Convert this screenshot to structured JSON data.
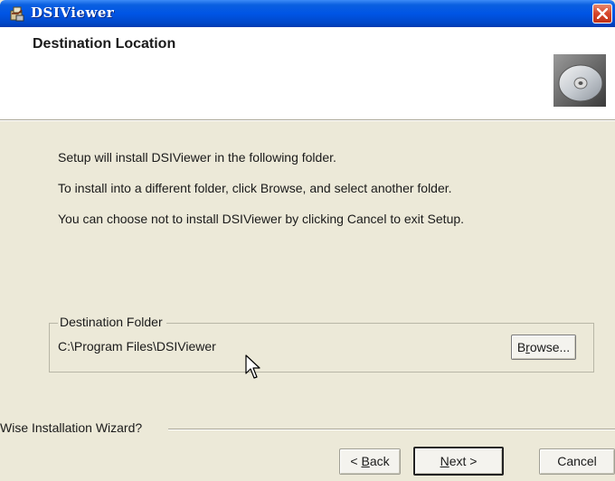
{
  "window": {
    "title": "DSIViewer"
  },
  "header": {
    "title": "Destination Location"
  },
  "body": {
    "lines": [
      "Setup will install DSIViewer in the following folder.",
      "To install into a different folder, click Browse, and select another folder.",
      "You can choose not to install DSIViewer by clicking Cancel to exit Setup."
    ]
  },
  "destination": {
    "legend": "Destination Folder",
    "path": "C:\\Program Files\\DSIViewer",
    "browse_label_pre": "B",
    "browse_label_accel": "r",
    "browse_label_post": "owse..."
  },
  "footer": {
    "label": "Wise Installation Wizard?",
    "back_label_pre": "< ",
    "back_label_accel": "B",
    "back_label_post": "ack",
    "next_label_accel": "N",
    "next_label_post": "ext >",
    "cancel_label": "Cancel"
  },
  "icons": {
    "title_icon": "installer-app-icon",
    "header_icon": "cd-disc-icon",
    "close_icon": "close-icon",
    "cursor": "mouse-pointer-icon"
  },
  "colors": {
    "titlebar": "#0055e5",
    "close_button": "#d6452a",
    "dialog_background": "#ece9d8",
    "header_background": "#ffffff"
  }
}
